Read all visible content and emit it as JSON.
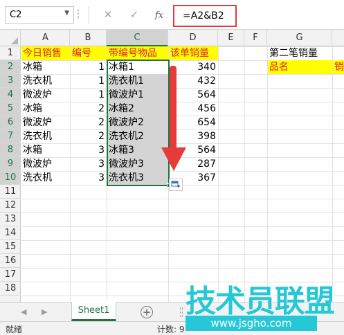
{
  "formula_bar": {
    "name_box": "C2",
    "cancel_icon": "✕",
    "enter_icon": "✓",
    "fx_label": "fx",
    "formula": "=A2&B2"
  },
  "columns": [
    "A",
    "B",
    "C",
    "D",
    "E",
    "F",
    "G"
  ],
  "selected_column": "C",
  "rows": [
    "1",
    "2",
    "3",
    "4",
    "5",
    "6",
    "7",
    "8",
    "9",
    "10",
    "11",
    "12",
    "13",
    "14",
    "15",
    "16",
    "17",
    "18"
  ],
  "table": {
    "headers": [
      "今日销售",
      "编号",
      "带编号物品",
      "该单销量"
    ],
    "rows": [
      [
        "冰箱",
        "1",
        "冰箱1",
        "340"
      ],
      [
        "洗衣机",
        "1",
        "洗衣机1",
        "432"
      ],
      [
        "微波炉",
        "1",
        "微波炉1",
        "564"
      ],
      [
        "冰箱",
        "2",
        "冰箱2",
        "456"
      ],
      [
        "微波炉",
        "2",
        "微波炉2",
        "654"
      ],
      [
        "洗衣机",
        "2",
        "洗衣机2",
        "398"
      ],
      [
        "冰箱",
        "3",
        "冰箱3",
        "564"
      ],
      [
        "微波炉",
        "3",
        "微波炉3",
        "287"
      ],
      [
        "洗衣机",
        "3",
        "洗衣机3",
        "367"
      ]
    ]
  },
  "side_table": {
    "title": "第二笔销量",
    "header_g": "品名",
    "header_h": "销"
  },
  "sheet_tabs": {
    "active": "Sheet1",
    "add_icon": "⊕"
  },
  "nav": {
    "prev": "◀",
    "next": "▶"
  },
  "status": {
    "ready": "就绪",
    "count": "计数: 9"
  },
  "watermark": {
    "main": "技术员联盟",
    "url": "www.jsgho.com"
  },
  "colors": {
    "accent": "#217346",
    "header_fill": "#ffff00",
    "header_text": "#e02020",
    "arrow": "#e53b3b",
    "watermark": "#26c7d6"
  }
}
